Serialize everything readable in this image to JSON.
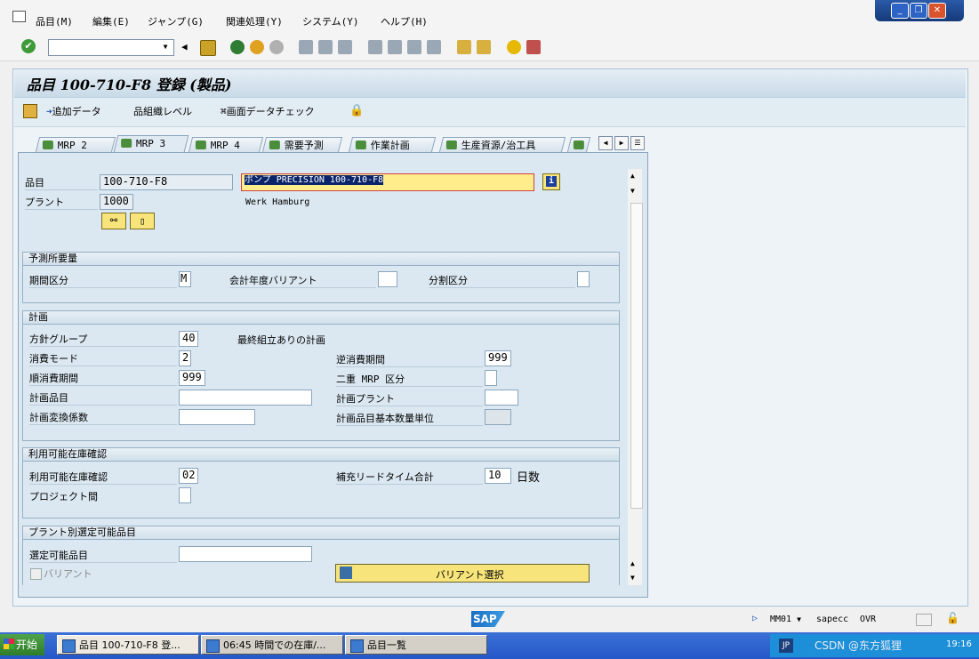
{
  "menu": [
    "品目(M)",
    "編集(E)",
    "ジャンプ(G)",
    "関連処理(Y)",
    "システム(Y)",
    "ヘルプ(H)"
  ],
  "page_title": "品目 100-710-F8 登録 (製品)",
  "app_toolbar": {
    "additional_data": "追加データ",
    "org_level": "組織レベル",
    "check_screen_data": "画面データチェック"
  },
  "tabs": [
    "MRP 2",
    "MRP 3",
    "MRP 4",
    "需要予測",
    "作業計画",
    "生産資源/治工具"
  ],
  "active_tab": "MRP 3",
  "header": {
    "material_label": "品目",
    "material_value": "100-710-F8",
    "description_value": "ポンプ PRECISION 100-710-F8",
    "plant_label": "プラント",
    "plant_value": "1000",
    "plant_name": "Werk Hamburg"
  },
  "forecast": {
    "title": "予測所要量",
    "period_label": "期間区分",
    "period_value": "M",
    "fiscal_label": "会計年度バリアント",
    "split_label": "分割区分"
  },
  "planning": {
    "title": "計画",
    "strategy_label": "方針グループ",
    "strategy_value": "40",
    "strategy_text": "最終組立ありの計画",
    "consumption_mode_label": "消費モード",
    "consumption_mode_value": "2",
    "bwd_label": "逆消費期間",
    "bwd_value": "999",
    "fwd_label": "順消費期間",
    "fwd_value": "999",
    "mixed_mrp_label": "二重 MRP 区分",
    "planning_material_label": "計画品目",
    "planning_plant_label": "計画プラント",
    "conv_factor_label": "計画変換係数",
    "plan_uom_label": "計画品目基本数量単位"
  },
  "availability": {
    "title": "利用可能在庫確認",
    "check_label": "利用可能在庫確認",
    "check_value": "02",
    "lead_time_label": "補充リードタイム合計",
    "lead_time_value": "10",
    "days_unit": "日数",
    "cross_project_label": "プロジェクト間"
  },
  "configurable": {
    "title": "プラント別選定可能品目",
    "material_label": "選定可能品目",
    "variant_label": "バリアント",
    "variant_button": "バリアント選択"
  },
  "status": {
    "transaction": "MM01",
    "system": "sapecc",
    "mode": "OVR",
    "sap_logo": "SAP"
  },
  "taskbar": {
    "start": "开始",
    "items": [
      "品目 100-710-F8 登...",
      "06:45 時間での在庫/...",
      "品目一覧"
    ],
    "lang": "JP",
    "watermark": "CSDN @东方狐狸",
    "clock": "19:16"
  },
  "colors": {
    "description_bg": "#ffec8b",
    "variant_button_bg": "#f7e47a",
    "taskbar": "#2558c8"
  }
}
